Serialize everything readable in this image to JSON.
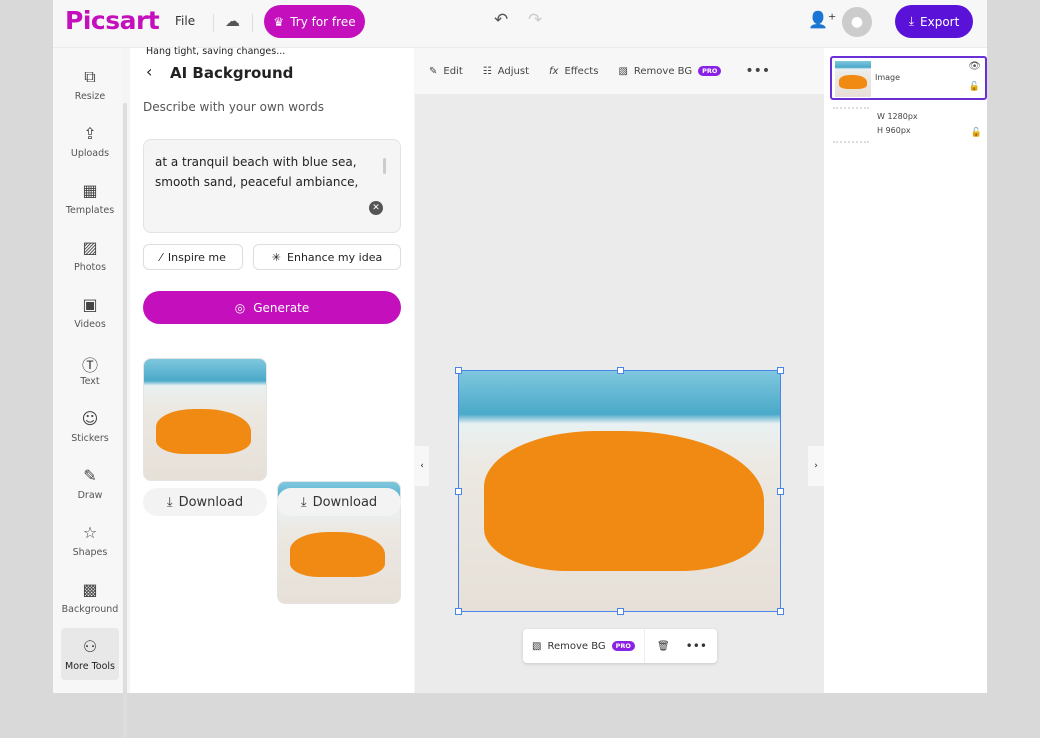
{
  "header": {
    "logo": "Picsart",
    "file": "File",
    "try_label": "Try for free",
    "export_label": "Export"
  },
  "sidebar": {
    "items": [
      {
        "label": "Resize",
        "icon": "resize-icon"
      },
      {
        "label": "Uploads",
        "icon": "upload-icon"
      },
      {
        "label": "Templates",
        "icon": "templates-icon"
      },
      {
        "label": "Photos",
        "icon": "photo-icon"
      },
      {
        "label": "Videos",
        "icon": "video-icon"
      },
      {
        "label": "Text",
        "icon": "text-icon"
      },
      {
        "label": "Stickers",
        "icon": "sticker-icon"
      },
      {
        "label": "Draw",
        "icon": "brush-icon"
      },
      {
        "label": "Shapes",
        "icon": "star-icon"
      },
      {
        "label": "Background",
        "icon": "background-icon"
      },
      {
        "label": "More Tools",
        "icon": "more-tools-icon"
      }
    ]
  },
  "panel": {
    "status": "Hang tight, saving changes...",
    "title": "AI Background",
    "describe": "Describe with your own words",
    "prompt": "at a tranquil beach with blue sea, smooth sand, peaceful ambiance,",
    "inspire": "Inspire me",
    "enhance": "Enhance my idea",
    "generate": "Generate",
    "download": "Download"
  },
  "toolbar": {
    "edit": "Edit",
    "adjust": "Adjust",
    "effects": "Effects",
    "remove_bg": "Remove BG",
    "pro": "PRO"
  },
  "layers": {
    "image_label": "Image",
    "width": "W 1280px",
    "height": "H 960px"
  },
  "colors": {
    "brand": "#c40fbd",
    "export": "#5a11d8",
    "selection": "#4a86e8"
  }
}
